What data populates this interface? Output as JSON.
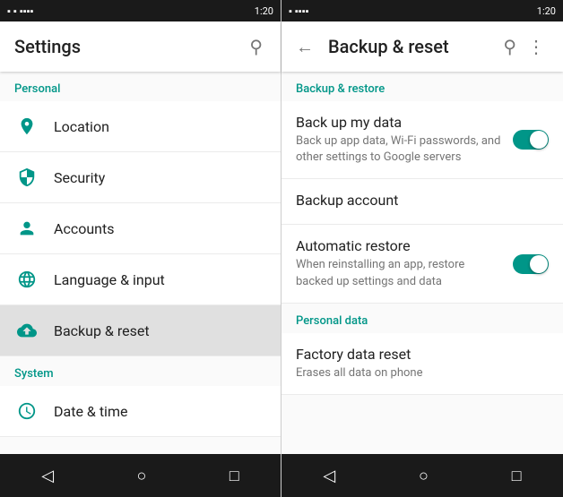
{
  "left_panel": {
    "status_time": "1:20",
    "toolbar_title": "Settings",
    "section_personal": "Personal",
    "section_system": "System",
    "items": [
      {
        "id": "location",
        "label": "Location",
        "icon": "location"
      },
      {
        "id": "security",
        "label": "Security",
        "icon": "security"
      },
      {
        "id": "accounts",
        "label": "Accounts",
        "icon": "accounts"
      },
      {
        "id": "language",
        "label": "Language & input",
        "icon": "language"
      },
      {
        "id": "backup",
        "label": "Backup & reset",
        "icon": "backup",
        "active": true
      }
    ],
    "system_items": [
      {
        "id": "datetime",
        "label": "Date & time",
        "icon": "clock"
      }
    ]
  },
  "right_panel": {
    "status_time": "1:20",
    "toolbar_title": "Backup & reset",
    "section_backup_restore": "Backup & restore",
    "section_personal_data": "Personal data",
    "items": [
      {
        "id": "backup_data",
        "title": "Back up my data",
        "subtitle": "Back up app data, Wi-Fi passwords, and other settings to Google servers",
        "toggle": true,
        "toggle_on": true
      },
      {
        "id": "backup_account",
        "title": "Backup account",
        "subtitle": "",
        "toggle": false,
        "toggle_on": false
      },
      {
        "id": "auto_restore",
        "title": "Automatic restore",
        "subtitle": "When reinstalling an app, restore backed up settings and data",
        "toggle": true,
        "toggle_on": true
      }
    ],
    "personal_items": [
      {
        "id": "factory_reset",
        "title": "Factory data reset",
        "subtitle": "Erases all data on phone",
        "toggle": false
      }
    ]
  },
  "nav": {
    "back": "◁",
    "home": "○",
    "recent": "□"
  }
}
